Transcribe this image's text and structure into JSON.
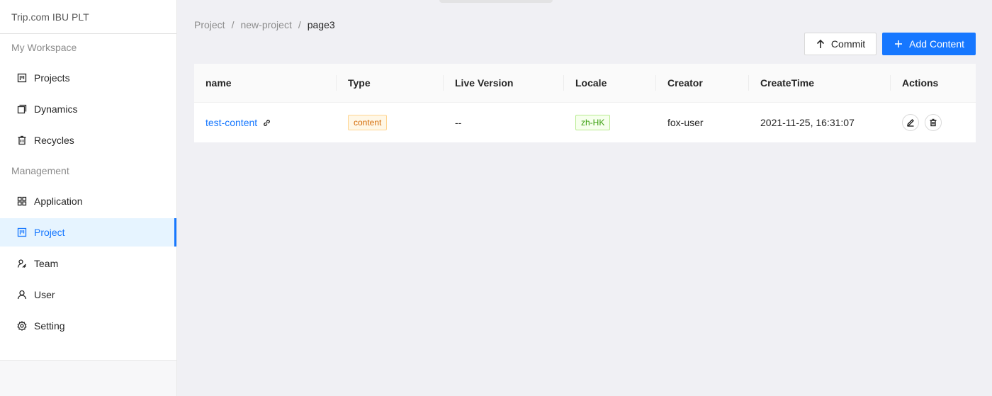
{
  "brand": "Trip.com IBU PLT",
  "sidebar": {
    "group1": "My Workspace",
    "group2": "Management",
    "items": [
      {
        "label": "Projects",
        "icon": "board-icon"
      },
      {
        "label": "Dynamics",
        "icon": "copy-icon"
      },
      {
        "label": "Recycles",
        "icon": "trash-icon"
      },
      {
        "label": "Application",
        "icon": "appstore-icon"
      },
      {
        "label": "Project",
        "icon": "board-icon",
        "active": true
      },
      {
        "label": "Team",
        "icon": "team-icon"
      },
      {
        "label": "User",
        "icon": "user-icon"
      },
      {
        "label": "Setting",
        "icon": "gear-icon"
      }
    ]
  },
  "breadcrumb": [
    "Project",
    "new-project",
    "page3"
  ],
  "buttons": {
    "commit": "Commit",
    "add": "Add Content"
  },
  "table": {
    "columns": [
      "name",
      "Type",
      "Live Version",
      "Locale",
      "Creator",
      "CreateTime",
      "Actions"
    ],
    "rows": [
      {
        "name": "test-content",
        "type": "content",
        "live_version": "--",
        "locale": "zh-HK",
        "creator": "fox-user",
        "create_time": "2021-11-25, 16:31:07"
      }
    ]
  },
  "colors": {
    "primary": "#1677ff",
    "background": "#f0f0f4"
  }
}
